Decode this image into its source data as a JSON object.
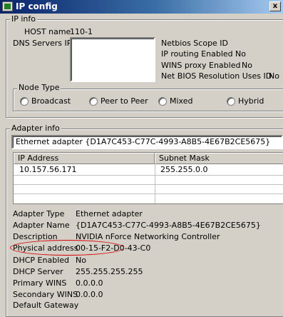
{
  "window": {
    "title": "IP config",
    "close_glyph": "x"
  },
  "ip_info": {
    "group_title": "IP info",
    "host_name_label": "HOST name",
    "host_name_value": "110-1",
    "dns_label": "DNS Servers IP",
    "netbios_scope_label": "Netbios Scope ID",
    "ip_routing_label": "IP routing Enabled",
    "ip_routing_value": "No",
    "wins_proxy_label": "WINS proxy Enabled",
    "wins_proxy_value": "No",
    "netbios_res_label": "Net BIOS Resolution Uses ID",
    "netbios_res_value": "No"
  },
  "node_type": {
    "group_title": "Node Type",
    "options": [
      "Broadcast",
      "Peer to Peer",
      "Mixed",
      "Hybrid"
    ]
  },
  "adapter_info": {
    "group_title": "Adapter info",
    "selected_adapter": "Ethernet adapter {D1A7C453-C77C-4993-A8B5-4E67B2CE5675}",
    "columns": [
      "IP Address",
      "Subnet Mask"
    ],
    "rows": [
      {
        "ip": "10.157.56.171",
        "mask": "255.255.0.0"
      }
    ],
    "details": [
      {
        "label": "Adapter Type",
        "value": "Ethernet adapter"
      },
      {
        "label": "Adapter Name",
        "value": "{D1A7C453-C77C-4993-A8B5-4E67B2CE5675}"
      },
      {
        "label": "Description",
        "value": "NVIDIA nForce Networking Controller"
      },
      {
        "label": "Physical address",
        "value": "00-15-F2-D0-43-C0"
      },
      {
        "label": "DHCP Enabled",
        "value": "No"
      },
      {
        "label": "DHCP Server",
        "value": "255.255.255.255"
      },
      {
        "label": "Primary WINS",
        "value": "0.0.0.0"
      },
      {
        "label": "Secondary WINS",
        "value": "0.0.0.0"
      },
      {
        "label": "Default Gateway",
        "value": ""
      }
    ]
  },
  "colors": {
    "titlebar_start": "#0a246a",
    "titlebar_end": "#a6caf0",
    "window_bg": "#d4d0c8",
    "highlight": "#d40000"
  },
  "icons": {
    "app": "network-app-icon",
    "close": "close-icon"
  }
}
